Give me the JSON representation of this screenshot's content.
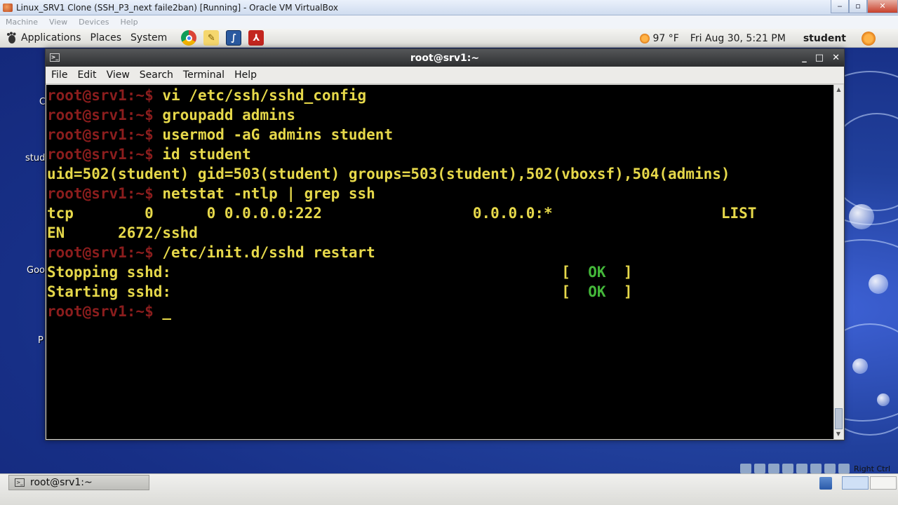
{
  "host_window": {
    "title": "Linux_SRV1 Clone (SSH_P3_next faile2ban) [Running] - Oracle VM VirtualBox",
    "menu": [
      "Machine",
      "View",
      "Devices",
      "Help"
    ],
    "host_key_label": "Right Ctrl"
  },
  "top_panel": {
    "menus": [
      "Applications",
      "Places",
      "System"
    ],
    "launchers": [
      "chrome-icon",
      "notes-icon",
      "matlab-icon",
      "pdf-reader-icon"
    ],
    "weather": "97 °F",
    "clock": "Fri Aug 30,  5:21 PM",
    "user": "student"
  },
  "desktop_labels": [
    "C",
    "stud",
    "Goo",
    "P"
  ],
  "terminal": {
    "title": "root@srv1:~",
    "menu": [
      "File",
      "Edit",
      "View",
      "Search",
      "Terminal",
      "Help"
    ],
    "lines": [
      {
        "prompt": "root@srv1:~$ ",
        "text": "vi /etc/ssh/sshd_config"
      },
      {
        "prompt": "root@srv1:~$ ",
        "text": "groupadd admins"
      },
      {
        "prompt": "root@srv1:~$ ",
        "text": "usermod -aG admins student"
      },
      {
        "prompt": "root@srv1:~$ ",
        "text": "id student"
      },
      {
        "prompt": "",
        "text": "uid=502(student) gid=503(student) groups=503(student),502(vboxsf),504(admins)"
      },
      {
        "prompt": "root@srv1:~$ ",
        "text": "netstat -ntlp | grep ssh"
      },
      {
        "prompt": "",
        "text": "tcp        0      0 0.0.0.0:222                 0.0.0.0:*                   LIST"
      },
      {
        "prompt": "",
        "text": "EN      2672/sshd"
      },
      {
        "prompt": "root@srv1:~$ ",
        "text": "/etc/init.d/sshd restart"
      },
      {
        "prompt": "",
        "text": "Stopping sshd:                                            [  ",
        "ok": "OK",
        "after": "  ]"
      },
      {
        "prompt": "",
        "text": "Starting sshd:                                            [  ",
        "ok": "OK",
        "after": "  ]"
      },
      {
        "prompt": "root@srv1:~$ ",
        "text": "",
        "cursor": "_"
      }
    ]
  },
  "bottom_panel": {
    "task": "root@srv1:~"
  }
}
